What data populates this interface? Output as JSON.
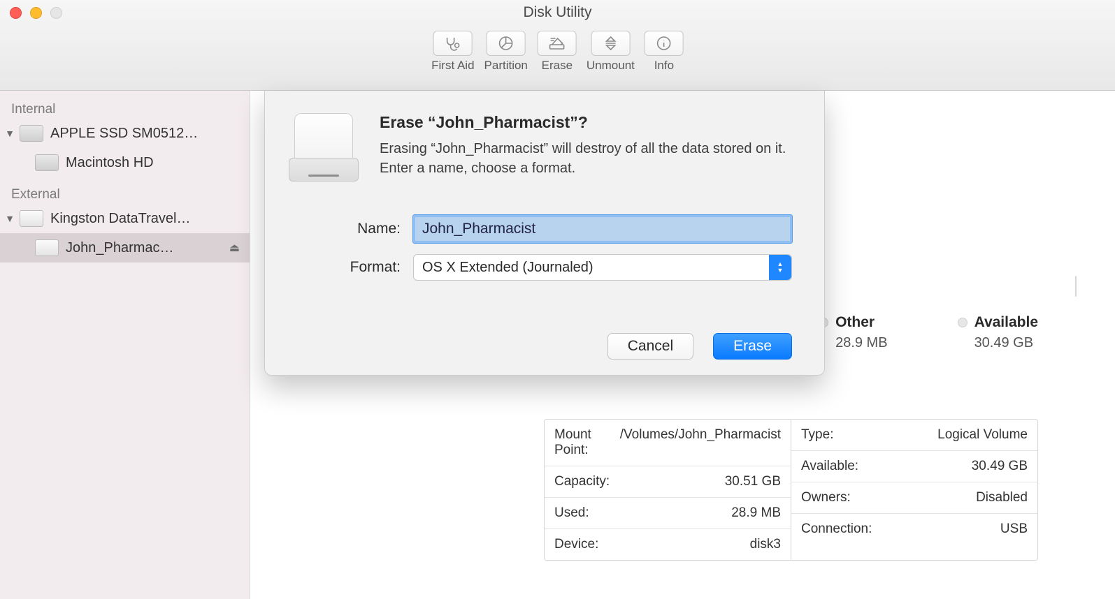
{
  "window": {
    "title": "Disk Utility"
  },
  "toolbar": {
    "first_aid": "First Aid",
    "partition": "Partition",
    "erase": "Erase",
    "unmount": "Unmount",
    "info": "Info"
  },
  "sidebar": {
    "sections": {
      "internal": "Internal",
      "external": "External"
    },
    "internal_items": [
      {
        "label": "APPLE SSD SM0512…"
      },
      {
        "label": "Macintosh HD"
      }
    ],
    "external_items": [
      {
        "label": "Kingston DataTravel…"
      },
      {
        "label": "John_Pharmac…"
      }
    ]
  },
  "usage": {
    "other_label": "Other",
    "other_value": "28.9 MB",
    "available_label": "Available",
    "available_value": "30.49 GB"
  },
  "details": {
    "left": [
      {
        "k": "Mount Point:",
        "v": "/Volumes/John_Pharmacist"
      },
      {
        "k": "Capacity:",
        "v": "30.51 GB"
      },
      {
        "k": "Used:",
        "v": "28.9 MB"
      },
      {
        "k": "Device:",
        "v": "disk3"
      }
    ],
    "right": [
      {
        "k": "Type:",
        "v": "Logical Volume"
      },
      {
        "k": "Available:",
        "v": "30.49 GB"
      },
      {
        "k": "Owners:",
        "v": "Disabled"
      },
      {
        "k": "Connection:",
        "v": "USB"
      }
    ]
  },
  "sheet": {
    "title": "Erase “John_Pharmacist”?",
    "description": "Erasing “John_Pharmacist” will destroy of all the data stored on it. Enter a name, choose a format.",
    "name_label": "Name:",
    "name_value": "John_Pharmacist",
    "format_label": "Format:",
    "format_value": "OS X Extended (Journaled)",
    "cancel": "Cancel",
    "erase": "Erase"
  }
}
